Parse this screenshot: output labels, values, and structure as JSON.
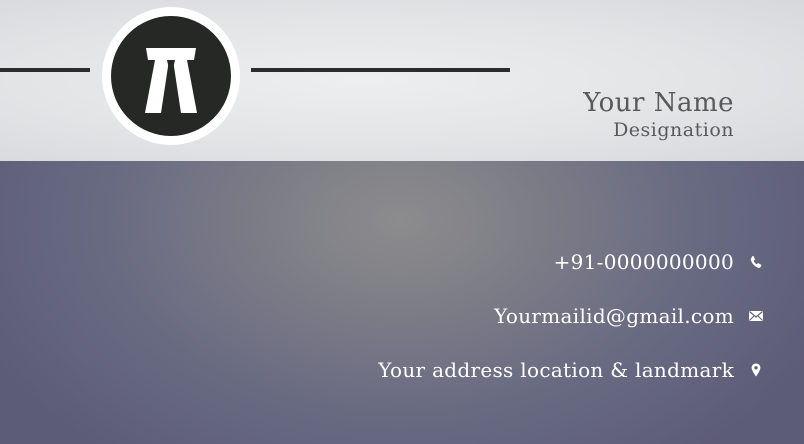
{
  "card": {
    "name": "Your Name",
    "designation": "Designation",
    "logo_icon": "advocate-bands-icon"
  },
  "contacts": [
    {
      "text": "+91-0000000000",
      "icon": "phone-icon"
    },
    {
      "text": "Yourmailid@gmail.com",
      "icon": "envelope-icon"
    },
    {
      "text": "Your address location & landmark",
      "icon": "map-pin-icon"
    }
  ],
  "colors": {
    "top_band": "#e2e4e6",
    "bottom_band": "#5d5c78",
    "logo_disc": "#262826",
    "rule": "#2b2c2e",
    "name_text": "#58595b",
    "contact_text": "#ffffff"
  }
}
